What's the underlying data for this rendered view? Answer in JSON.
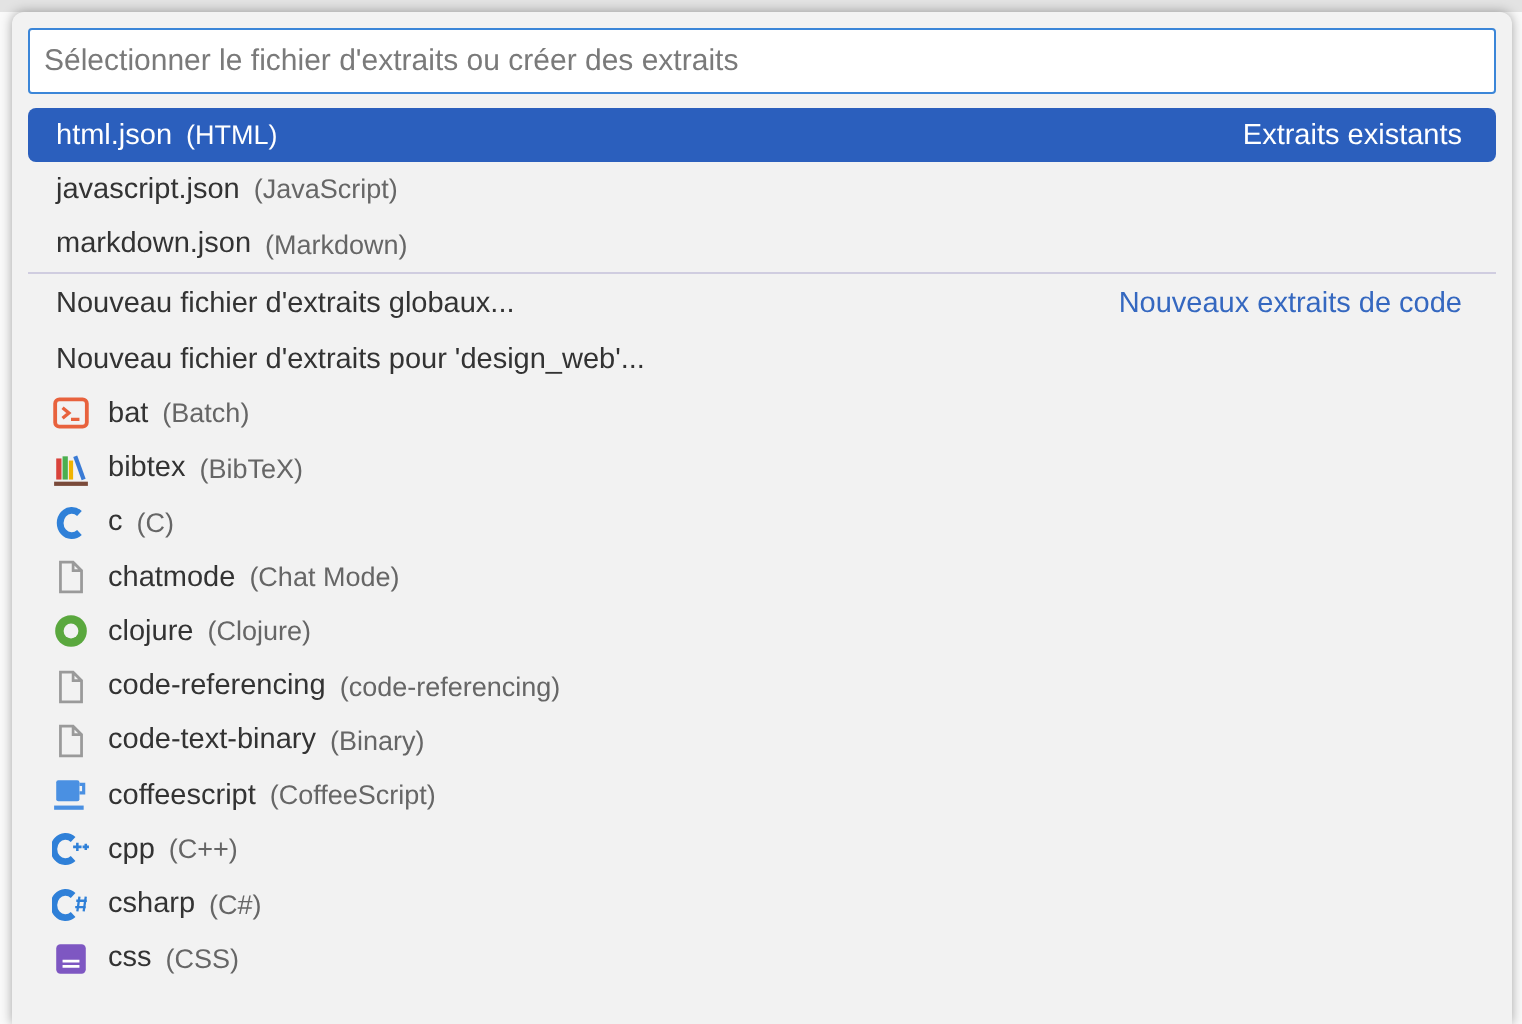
{
  "input": {
    "placeholder": "Sélectionner le fichier d'extraits ou créer des extraits"
  },
  "groups": [
    {
      "label": "Extraits existants",
      "items": [
        {
          "kind": "file",
          "name": "html.json",
          "detail": "(HTML)",
          "selected": true
        },
        {
          "kind": "file",
          "name": "javascript.json",
          "detail": "(JavaScript)",
          "selected": false
        },
        {
          "kind": "file",
          "name": "markdown.json",
          "detail": "(Markdown)",
          "selected": false
        }
      ]
    },
    {
      "label": "Nouveaux extraits de code",
      "items": [
        {
          "kind": "command",
          "name": "Nouveau fichier d'extraits globaux...",
          "selected": false
        },
        {
          "kind": "command",
          "name": "Nouveau fichier d'extraits pour 'design_web'...",
          "selected": false
        },
        {
          "kind": "language",
          "name": "bat",
          "detail": "(Batch)",
          "selected": false
        },
        {
          "kind": "language",
          "name": "bibtex",
          "detail": "(BibTeX)",
          "selected": false
        },
        {
          "kind": "language",
          "name": "c",
          "detail": "(C)",
          "selected": false
        },
        {
          "kind": "language",
          "name": "chatmode",
          "detail": "(Chat Mode)",
          "selected": false
        },
        {
          "kind": "language",
          "name": "clojure",
          "detail": "(Clojure)",
          "selected": false
        },
        {
          "kind": "language",
          "name": "code-referencing",
          "detail": "(code-referencing)",
          "selected": false
        },
        {
          "kind": "language",
          "name": "code-text-binary",
          "detail": "(Binary)",
          "selected": false
        },
        {
          "kind": "language",
          "name": "coffeescript",
          "detail": "(CoffeeScript)",
          "selected": false
        },
        {
          "kind": "language",
          "name": "cpp",
          "detail": "(C++)",
          "selected": false
        },
        {
          "kind": "language",
          "name": "csharp",
          "detail": "(C#)",
          "selected": false
        },
        {
          "kind": "language",
          "name": "css",
          "detail": "(CSS)",
          "selected": false
        }
      ]
    }
  ]
}
